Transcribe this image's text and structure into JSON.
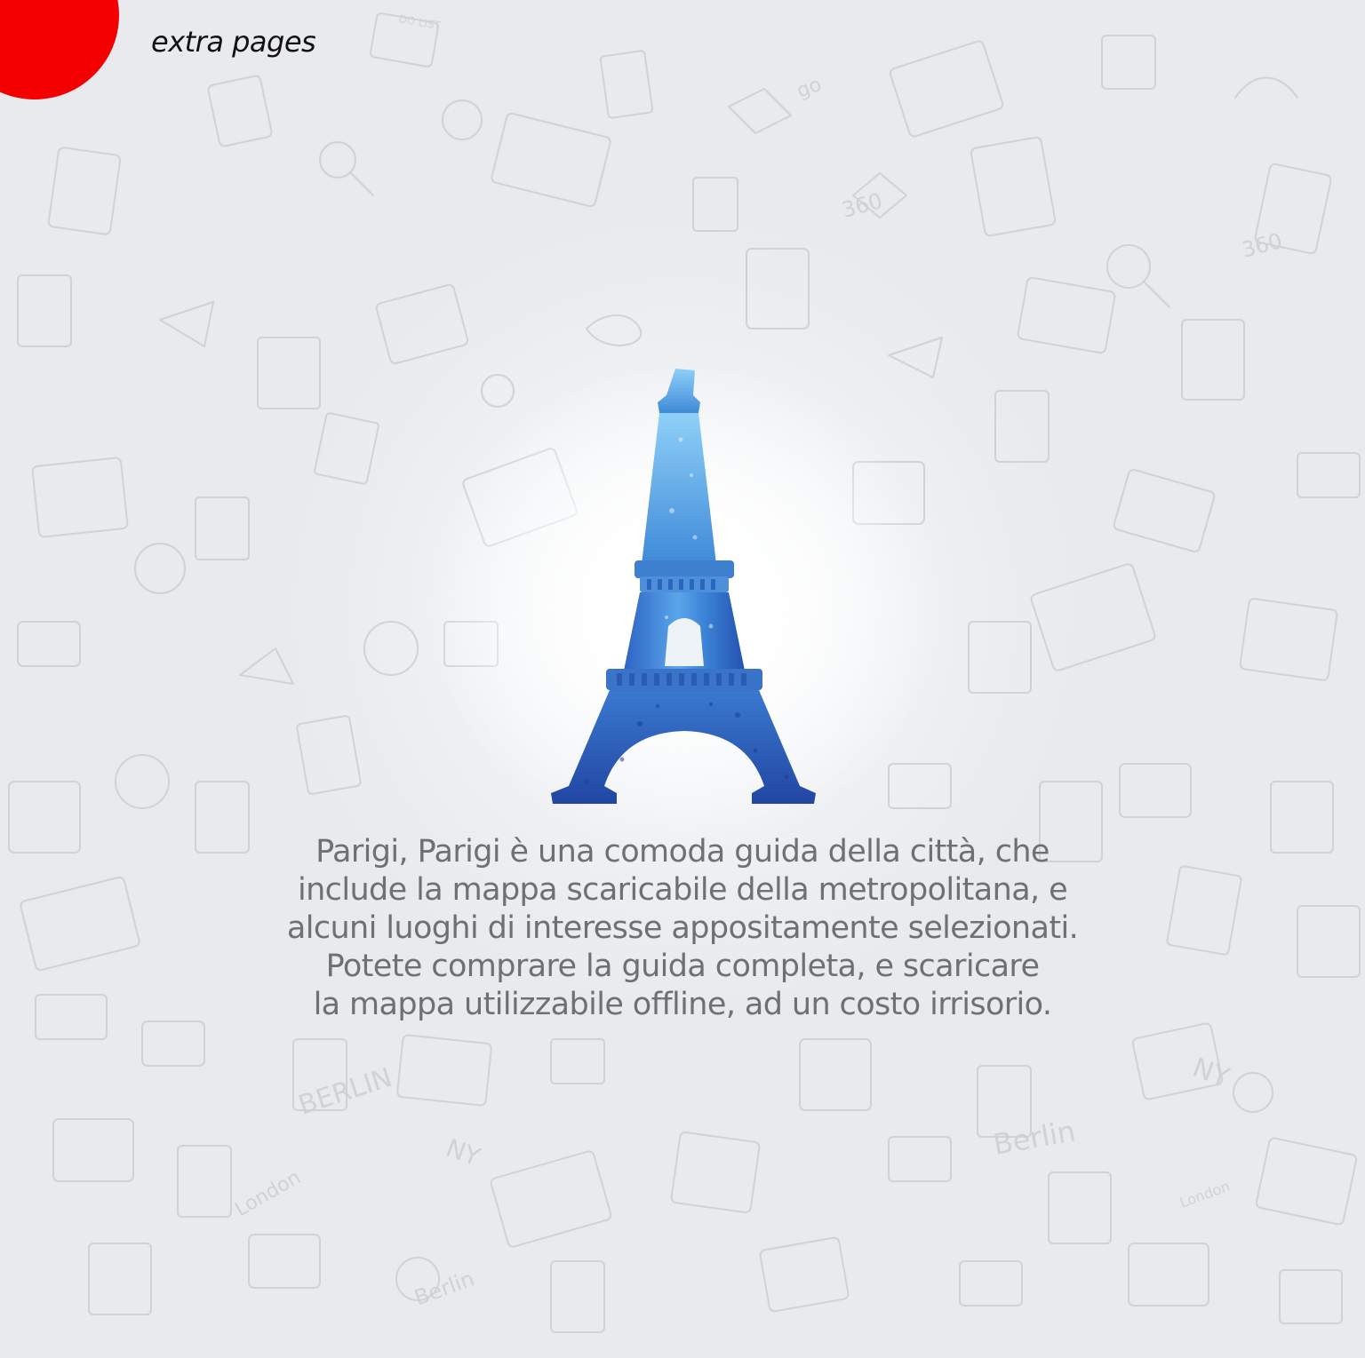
{
  "header": {
    "label": "extra pages"
  },
  "illustration": {
    "icon": "eiffel-tower-icon",
    "primary_color": "#3b7fd0",
    "accent_color": "#2a5fb8"
  },
  "description": {
    "lines": [
      "Parigi, Parigi è una comoda guida della città, che",
      "include la mappa scaricabile della metropolitana, e",
      "alcuni luoghi di interesse appositamente selezionati.",
      "Potete comprare la guida completa, e scaricare",
      "la mappa utilizzabile offline, ad un costo irrisorio."
    ]
  },
  "background": {
    "doodle_words": [
      "BERLIN",
      "NY",
      "London",
      "Berlin",
      "360",
      "go",
      "DO LIST"
    ],
    "accent_dot_color": "#f50000"
  }
}
